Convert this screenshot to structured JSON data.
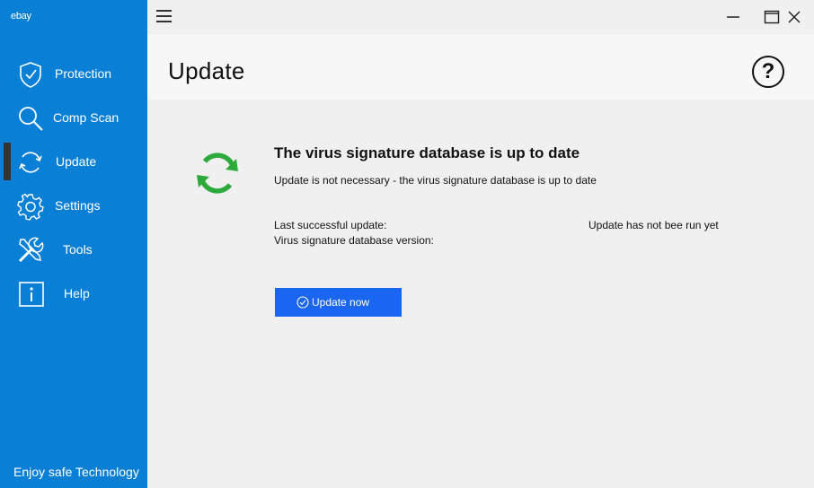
{
  "brand": "ebay",
  "sidebar": {
    "items": [
      {
        "label": "Protection",
        "icon": "shield-check-icon"
      },
      {
        "label": "Comp Scan",
        "icon": "magnifier-icon"
      },
      {
        "label": "Update",
        "icon": "refresh-icon",
        "active": true
      },
      {
        "label": "Settings",
        "icon": "gear-icon"
      },
      {
        "label": "Tools",
        "icon": "wrench-screwdriver-icon"
      },
      {
        "label": "Help",
        "icon": "info-icon"
      }
    ],
    "footer": "Enjoy safe Technology"
  },
  "header": {
    "title": "Update",
    "help_icon": "question-icon",
    "help_glyph": "?"
  },
  "main": {
    "status_icon": "sync-icon",
    "status_title": "The virus signature database is up to date",
    "status_subtitle": "Update is not necessary - the virus signature database is up to date",
    "last_update_label": "Last successful update:",
    "last_update_value": "Update has not bee run yet",
    "db_version_label": "Virus signature database version:",
    "db_version_value": "",
    "update_button_label": "Update now"
  },
  "colors": {
    "sidebar_bg": "#0a7fd6",
    "button_bg": "#1a66f0",
    "sync_green": "#2eaa3c"
  }
}
